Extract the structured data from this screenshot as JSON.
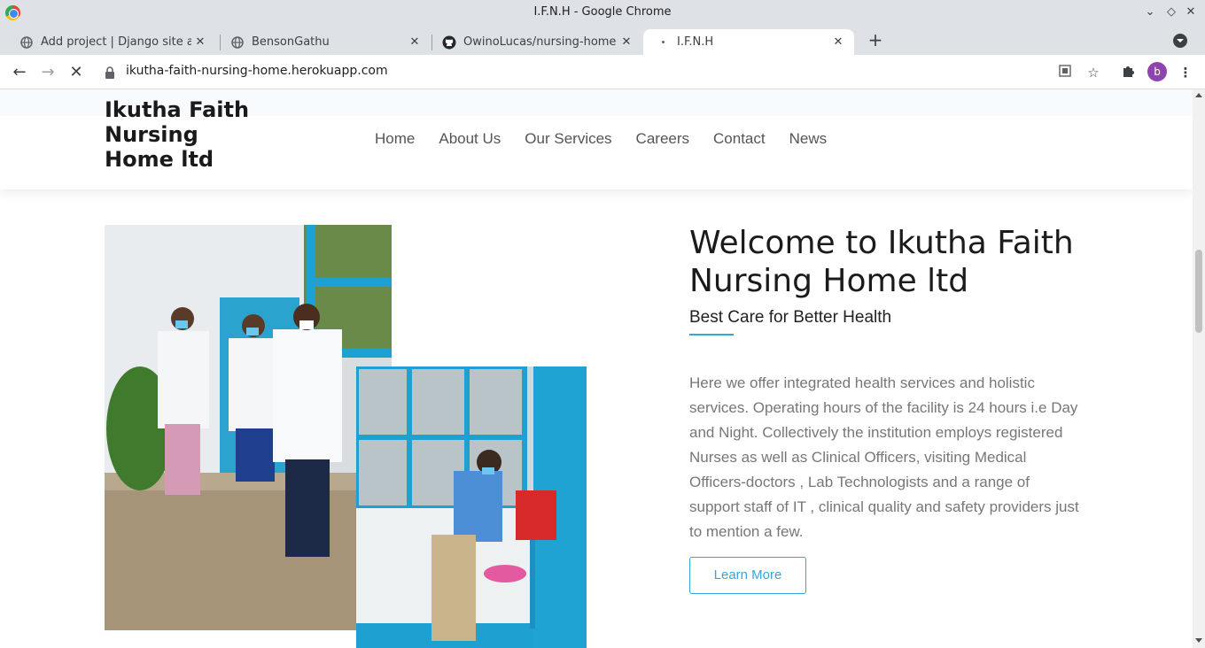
{
  "window": {
    "title": "I.F.N.H - Google Chrome"
  },
  "tabs": [
    {
      "label": "Add project | Django site adm",
      "icon": "globe-icon",
      "active": false
    },
    {
      "label": "BensonGathu",
      "icon": "globe-icon",
      "active": false
    },
    {
      "label": "OwinoLucas/nursing-home",
      "icon": "github-icon",
      "active": false
    },
    {
      "label": "I.F.N.H",
      "icon": "loading-icon",
      "active": true
    }
  ],
  "toolbar": {
    "url": "ikutha-faith-nursing-home.herokuapp.com",
    "profile_initial": "b"
  },
  "site": {
    "brand": "Ikutha Faith Nursing Home ltd",
    "nav": [
      "Home",
      "About Us",
      "Our Services",
      "Careers",
      "Contact",
      "News"
    ],
    "welcome_title": "Welcome to Ikutha Faith Nursing Home ltd",
    "tagline": "Best Care for Better Health",
    "description": "Here we offer integrated health services and holistic services. Operating hours of the facility is 24 hours i.e Day and Night. Collectively the institution employs registered Nurses as well as Clinical Officers, visiting Medical Officers-doctors , Lab Technologists and a range of support staff of IT , clinical quality and safety providers just to mention a few.",
    "learn_more": "Learn More"
  },
  "colors": {
    "accent": "#34a6d9",
    "chrome_frame": "#dee1e6"
  }
}
